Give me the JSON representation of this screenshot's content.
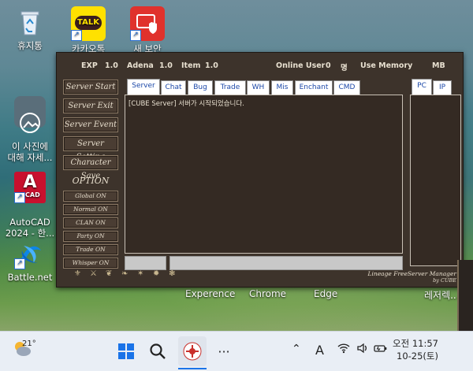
{
  "desktop": {
    "icons": [
      {
        "label": "휴지통",
        "icon": "recycle-bin-icon"
      },
      {
        "label": "카카오톡",
        "icon": "kakaotalk-icon",
        "badge": "TALK"
      },
      {
        "label": "새 보안",
        "icon": "security-shield-icon"
      },
      {
        "label": "이 사진에\n대해 자세...",
        "icon": "photo-info-icon"
      },
      {
        "label": "AutoCAD\n2024 - 한...",
        "icon": "autocad-icon",
        "badge": "A",
        "sub": "CAD"
      },
      {
        "label": "Battle.net",
        "icon": "battlenet-icon"
      }
    ],
    "below_labels": [
      "Experence",
      "Chrome",
      "Edge",
      "레저렉..."
    ]
  },
  "app": {
    "stats": {
      "exp_label": "EXP",
      "exp_value": "1.0",
      "adena_label": "Adena",
      "adena_value": "1.0",
      "item_label": "Item",
      "item_value": "1.0",
      "online_label": "Online User",
      "online_value": "0",
      "online_unit": "명",
      "memory_label": "Use Memory",
      "memory_unit": "MB"
    },
    "left_buttons": [
      "Server Start",
      "Server Exit",
      "Server Event",
      "Server Setting",
      "Character Save"
    ],
    "option_title": "OPTION",
    "option_buttons": [
      "Global ON",
      "Normal ON",
      "CLAN ON",
      "Party ON",
      "Trade ON",
      "Whisper ON"
    ],
    "tabs": [
      "Server",
      "Chat",
      "Bug",
      "Trade",
      "WH",
      "Mis",
      "Enchant",
      "CMD"
    ],
    "active_tab": "Server",
    "log_lines": [
      "[CUBE Server] 서버가 시작되었습니다."
    ],
    "right_tabs": [
      "PC",
      "IP"
    ],
    "credit_line1": "Lineage FreeServer Manager",
    "credit_line2": "by CUBE"
  },
  "taskbar": {
    "weather_temp": "21°",
    "time": "오전 11:57",
    "date": "10-25(토)",
    "ime": "A",
    "more": "···"
  },
  "colors": {
    "window_bg": "#3d332b",
    "panel_bg": "#342a23",
    "tab_text": "#1c48a8",
    "button_bg": "#4a3d33"
  }
}
